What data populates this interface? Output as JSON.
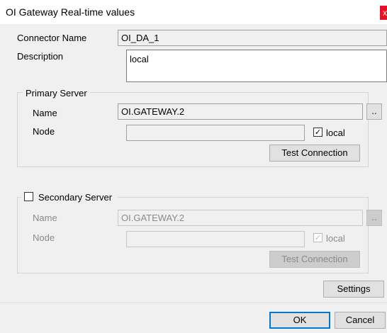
{
  "window": {
    "title": "OI Gateway Real-time values",
    "close_glyph": "x"
  },
  "connector": {
    "name_label": "Connector Name",
    "name_value": "OI_DA_1",
    "description_label": "Description",
    "description_value": "local"
  },
  "primary": {
    "legend": "Primary Server",
    "name_label": "Name",
    "name_value": "OI.GATEWAY.2",
    "browse_label": "..",
    "node_label": "Node",
    "node_value": "",
    "local_label": "local",
    "local_checked": true,
    "test_label": "Test Connection"
  },
  "secondary": {
    "legend": "Secondary Server",
    "enabled": false,
    "name_label": "Name",
    "name_value": "OI.GATEWAY.2",
    "browse_label": "..",
    "node_label": "Node",
    "node_value": "",
    "local_label": "local",
    "local_checked": true,
    "test_label": "Test Connection"
  },
  "buttons": {
    "settings": "Settings",
    "ok": "OK",
    "cancel": "Cancel"
  },
  "glyphs": {
    "check": "✓"
  }
}
